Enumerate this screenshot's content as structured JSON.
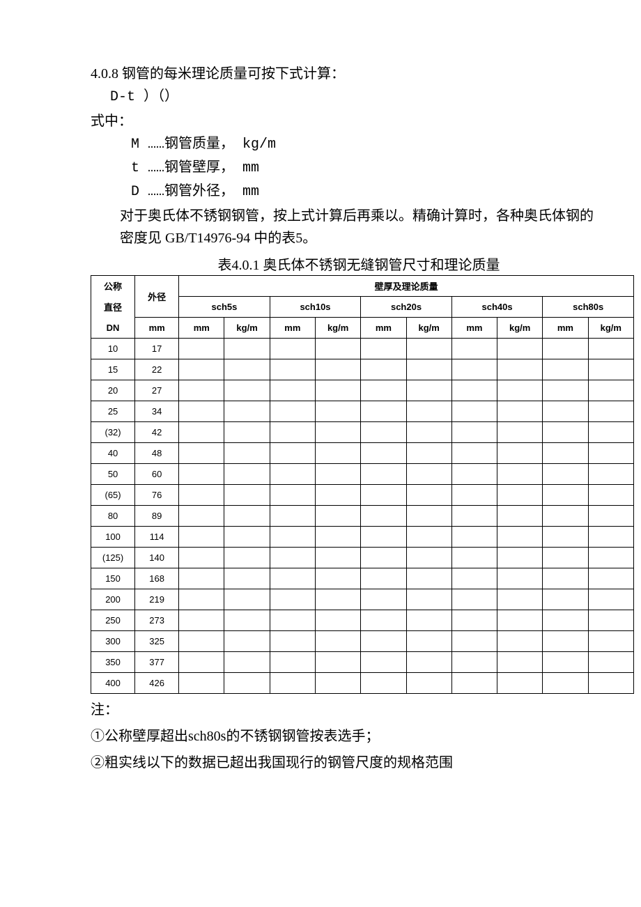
{
  "section_line": "4.0.8 钢管的每米理论质量可按下式计算：",
  "formula_line": "D-t ）（）",
  "where_label": "式中：",
  "defs": {
    "m": "M ……钢管质量，  kg/m",
    "t": "t ……钢管壁厚，  mm",
    "d": "D ……钢管外径，  mm"
  },
  "body_note": "对于奥氏体不锈钢钢管，按上式计算后再乘以。精确计算时，各种奥氏体钢的密度见 GB/T14976-94 中的表5。",
  "table_title": "表4.0.1 奥氏体不锈钢无缝钢管尺寸和理论质量",
  "table": {
    "header": {
      "dn_line1": "公称",
      "dn_line2": "直径",
      "dn_line3": "DN",
      "od_line1": "外径",
      "od_line2": "mm",
      "thick_group": "壁厚及理论质量",
      "sch": [
        "sch5s",
        "sch10s",
        "sch20s",
        "sch40s",
        "sch80s"
      ],
      "sub_mm": "mm",
      "sub_kgm": "kg/m"
    },
    "rows": [
      {
        "dn": "10",
        "od": "17"
      },
      {
        "dn": "15",
        "od": "22"
      },
      {
        "dn": "20",
        "od": "27"
      },
      {
        "dn": "25",
        "od": "34"
      },
      {
        "dn": "(32)",
        "od": "42"
      },
      {
        "dn": "40",
        "od": "48"
      },
      {
        "dn": "50",
        "od": "60"
      },
      {
        "dn": "(65)",
        "od": "76"
      },
      {
        "dn": "80",
        "od": "89"
      },
      {
        "dn": "100",
        "od": "114"
      },
      {
        "dn": "(125)",
        "od": "140"
      },
      {
        "dn": "150",
        "od": "168"
      },
      {
        "dn": "200",
        "od": "219"
      },
      {
        "dn": "250",
        "od": "273"
      },
      {
        "dn": "300",
        "od": "325"
      },
      {
        "dn": "350",
        "od": "377"
      },
      {
        "dn": "400",
        "od": "426"
      }
    ]
  },
  "notes": {
    "label": "注：",
    "n1": "①公称壁厚超出sch80s的不锈钢钢管按表选手；",
    "n2": "②粗实线以下的数据已超出我国现行的钢管尺度的规格范围"
  }
}
